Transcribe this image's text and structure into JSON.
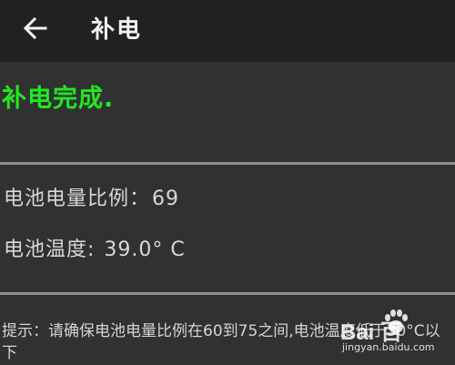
{
  "toolbar": {
    "back_icon": "arrow-left-icon",
    "title": "补电"
  },
  "status": {
    "text": "补电完成.",
    "color": "#22e822"
  },
  "battery": {
    "ratio_label": "电池电量比例：",
    "ratio_value": "69",
    "temp_label": "电池温度: ",
    "temp_value": "39.0° C"
  },
  "tip": {
    "text": "提示：请确保电池电量比例在60到75之间,电池温度低于30°C以下"
  },
  "watermark": {
    "brand": "Bai  百",
    "url": "jingyan.baidu.com"
  }
}
